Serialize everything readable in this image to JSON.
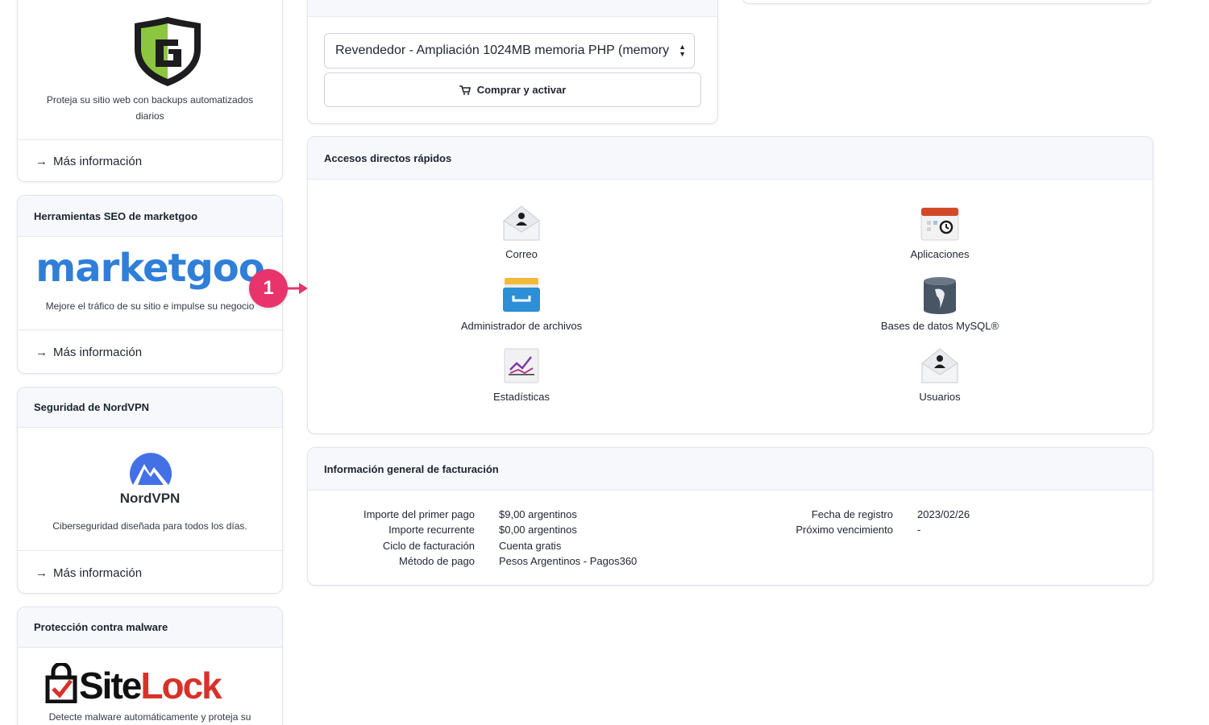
{
  "backup_card": {
    "description": "Proteja su sitio web con backups automatizados diarios",
    "more_link": "Más información"
  },
  "marketgoo_card": {
    "title": "Herramientas SEO de marketgoo",
    "logo_text": "marketgoo",
    "description": "Mejore el tráfico de su sitio e impulse su negocio",
    "more_link": "Más información"
  },
  "nordvpn_card": {
    "title": "Seguridad de NordVPN",
    "logo_text": "NordVPN",
    "description": "Ciberseguridad diseñada para todos los días.",
    "more_link": "Más información"
  },
  "sitelock_card": {
    "title": "Protección contra malware",
    "logo_text_site": "Site",
    "logo_text_lock": "Lock",
    "description": "Detecte malware automáticamente y proteja su"
  },
  "upgrade_card": {
    "select_value": "Revendedor - Ampliación 1024MB memoria PHP (memory",
    "buy_button": "Comprar y activar"
  },
  "annotation": {
    "marker": "1",
    "color": "#e8336d"
  },
  "quick_access": {
    "title": "Accesos directos rápidos",
    "items": [
      {
        "label": "Correo",
        "icon": "mail-icon"
      },
      {
        "label": "Aplicaciones",
        "icon": "calendar-apps-icon"
      },
      {
        "label": "Administrador de archivos",
        "icon": "file-cabinet-icon"
      },
      {
        "label": "Bases de datos MySQL®",
        "icon": "database-icon"
      },
      {
        "label": "Estadísticas",
        "icon": "stats-chart-icon"
      },
      {
        "label": "Usuarios",
        "icon": "user-envelope-icon"
      }
    ]
  },
  "billing": {
    "title": "Información general de facturación",
    "left": [
      {
        "label": "Importe del primer pago",
        "value": "$9,00 argentinos"
      },
      {
        "label": "Importe recurrente",
        "value": "$0,00 argentinos"
      },
      {
        "label": "Ciclo de facturación",
        "value": "Cuenta gratis"
      },
      {
        "label": "Método de pago",
        "value": "Pesos Argentinos - Pagos360"
      }
    ],
    "right": [
      {
        "label": "Fecha de registro",
        "value": "2023/02/26"
      },
      {
        "label": "Próximo vencimiento",
        "value": "-"
      }
    ]
  },
  "colors": {
    "marketgoo_blue": "#2f7fd8",
    "sitelock_red": "#d6322a",
    "codeguard_green": "#8cc63f"
  }
}
